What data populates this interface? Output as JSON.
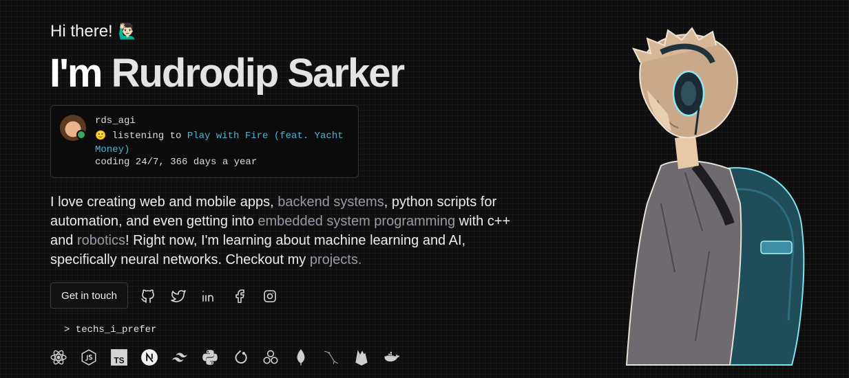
{
  "hero": {
    "greeting": "Hi there!",
    "wave_emoji": "🙋🏻‍♂️",
    "name_prefix": "I'm",
    "name": "Rudrodip Sarker"
  },
  "discord_card": {
    "username": "rds_agi",
    "status_emoji": "🙂",
    "status_prefix": "listening to",
    "song": "Play with Fire (feat. Yacht Money)",
    "bio": "coding 24/7, 366 days a year",
    "online_color": "#3ba55c",
    "song_color": "#4db4d6"
  },
  "about": {
    "t1": "I love creating web and mobile apps, ",
    "h1": "backend systems",
    "t2": ", python scripts for automation, and even getting into ",
    "h2": "embedded system programming",
    "t3": " with c++ and ",
    "h3": "robotics",
    "t4": "! Right now, I'm learning about machine learning and AI, specifically neural networks. Checkout my ",
    "h4": "projects."
  },
  "cta": {
    "label": "Get in touch"
  },
  "socials": [
    "github-icon",
    "twitter-icon",
    "linkedin-icon",
    "facebook-icon",
    "instagram-icon"
  ],
  "techs": {
    "prompt": "> techs_i_prefer",
    "ts_label": "TS",
    "items": [
      "react-icon",
      "nodejs-icon",
      "typescript-icon",
      "nextjs-icon",
      "tailwind-icon",
      "python-icon",
      "pytorch-icon",
      "gcp-icon",
      "mongodb-icon",
      "mysql-icon",
      "firebase-icon",
      "docker-icon"
    ]
  },
  "portrait": {
    "description_icon": "anime-boy-headphones-illustration"
  }
}
